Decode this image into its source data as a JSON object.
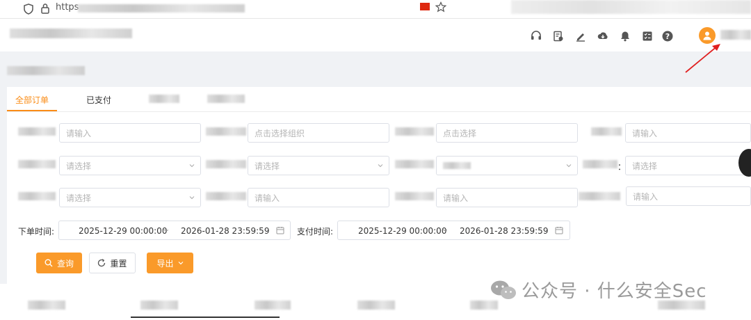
{
  "browser": {
    "url_prefix": "https",
    "icons": [
      "shield-icon",
      "lock-icon",
      "flag-icon",
      "star-icon"
    ]
  },
  "header": {
    "icons": [
      "headset-icon",
      "doc-icon",
      "edit-icon",
      "cloud-download-icon",
      "bell-icon",
      "checklist-icon",
      "help-icon",
      "user-avatar-icon"
    ]
  },
  "tabs": [
    {
      "label": "全部订单",
      "active": true
    },
    {
      "label": "已支付",
      "active": false
    }
  ],
  "filters": {
    "row1": [
      {
        "placeholder": "请输入",
        "type": "input"
      },
      {
        "placeholder": "点击选择组织",
        "type": "input"
      },
      {
        "placeholder": "点击选择",
        "type": "input"
      },
      {
        "placeholder": "请输入",
        "type": "input"
      }
    ],
    "row2": [
      {
        "placeholder": "请选择",
        "type": "select"
      },
      {
        "placeholder": "请选择",
        "type": "select"
      },
      {
        "placeholder": "",
        "type": "select"
      },
      {
        "placeholder": "请选择",
        "type": "input"
      }
    ],
    "row3": [
      {
        "placeholder": "请选择",
        "type": "select"
      },
      {
        "placeholder": "请输入",
        "type": "input"
      },
      {
        "placeholder": "请输入",
        "type": "input"
      },
      {
        "placeholder": "请输入",
        "type": "input"
      }
    ],
    "row2_label_suffix": "：",
    "order_time": {
      "label": "下单时间:",
      "start": "2025-12-29 00:00:00",
      "sep": "~",
      "end": "2026-01-28 23:59:59"
    },
    "pay_time": {
      "label": "支付时间:",
      "start": "2025-12-29 00:00:00",
      "sep": "~",
      "end": "2026-01-28 23:59:59"
    }
  },
  "buttons": {
    "search": "查询",
    "reset": "重置",
    "export": "导出"
  },
  "watermark": "公众号 · 什么安全Sec",
  "colors": {
    "accent": "#fa8c16",
    "button": "#fa9a2a",
    "avatar": "#fa9a2a",
    "arrow": "#e02020"
  }
}
